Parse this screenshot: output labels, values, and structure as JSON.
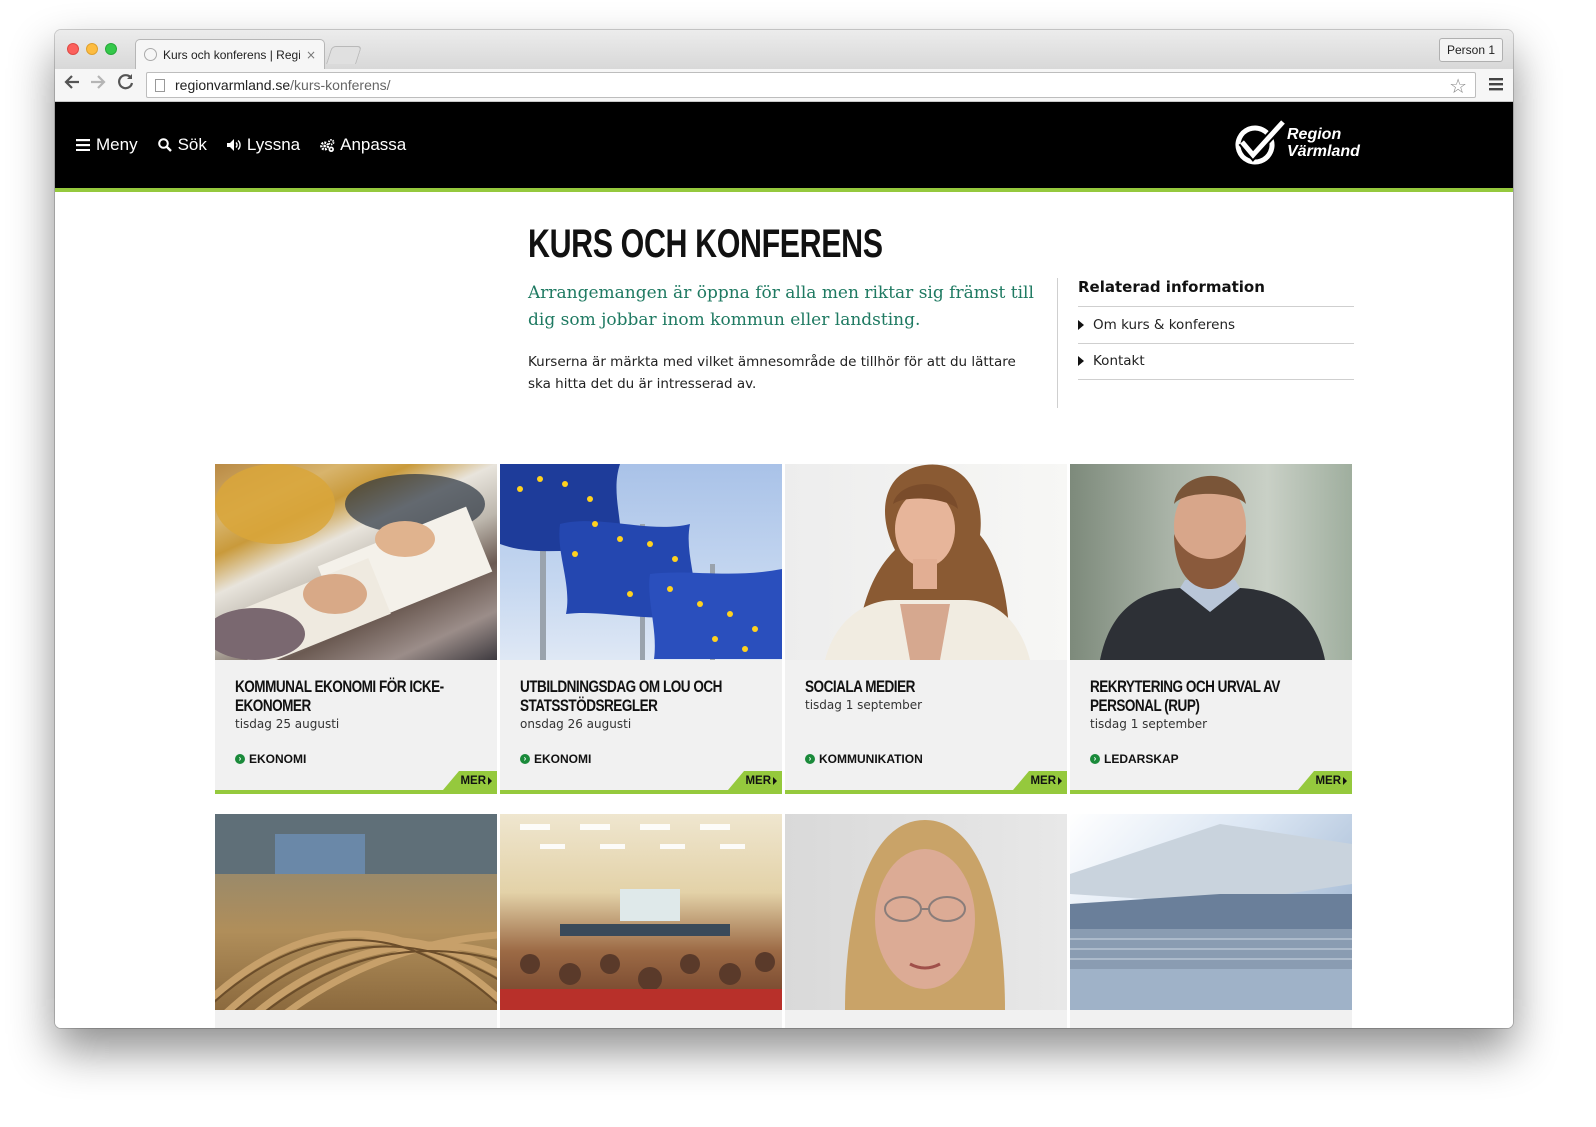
{
  "browser": {
    "tab_title": "Kurs och konferens | Regio",
    "tab_close": "×",
    "profile": "Person 1",
    "url_host": "regionvarmland.se",
    "url_path": "/kurs-konferens/",
    "icons": {
      "back": "arrow-left-icon",
      "forward": "arrow-right-icon",
      "reload": "reload-icon",
      "bookmark": "star-icon",
      "menu": "hamburger-menu-icon"
    }
  },
  "site": {
    "nav": [
      {
        "label": "Meny",
        "icon": "hamburger-icon"
      },
      {
        "label": "Sök",
        "icon": "search-icon"
      },
      {
        "label": "Lyssna",
        "icon": "speaker-icon"
      },
      {
        "label": "Anpassa",
        "icon": "gears-icon"
      }
    ],
    "logo": {
      "line1": "Region",
      "line2": "Värmland"
    },
    "accent_color": "#95c93d",
    "lead_color": "#1f7a62"
  },
  "page": {
    "title": "KURS OCH KONFERENS",
    "lead": "Arrangemangen är öppna för alla men riktar sig främst till dig som jobbar inom kommun eller landsting.",
    "body": "Kurserna är märkta med vilket ämnesområde de tillhör för att du lättare ska hitta det du är intresserad av."
  },
  "related": {
    "heading": "Relaterad information",
    "items": [
      "Om kurs & konferens",
      "Kontakt"
    ]
  },
  "cards": [
    {
      "title": "KOMMUNAL EKONOMI FÖR ICKE-EKONOMER",
      "date": "tisdag 25 augusti",
      "tag": "EKONOMI",
      "more": "MER",
      "image": "photo-hands-writing"
    },
    {
      "title": "UTBILDNINGSDAG OM LOU OCH STATSSTÖDSREGLER",
      "date": "onsdag 26 augusti",
      "tag": "EKONOMI",
      "more": "MER",
      "image": "photo-eu-flags"
    },
    {
      "title": "SOCIALA MEDIER",
      "date": "tisdag 1 september",
      "tag": "KOMMUNIKATION",
      "more": "MER",
      "image": "photo-woman-portrait"
    },
    {
      "title": "REKRYTERING OCH URVAL AV PERSONAL (RUP)",
      "date": "tisdag 1 september",
      "tag": "LEDARSKAP",
      "more": "MER",
      "image": "photo-man-portrait"
    },
    {
      "image": "photo-parliament-hall"
    },
    {
      "image": "photo-conference-audience"
    },
    {
      "image": "photo-woman-glasses-portrait"
    },
    {
      "image": "photo-laptop-books"
    }
  ]
}
